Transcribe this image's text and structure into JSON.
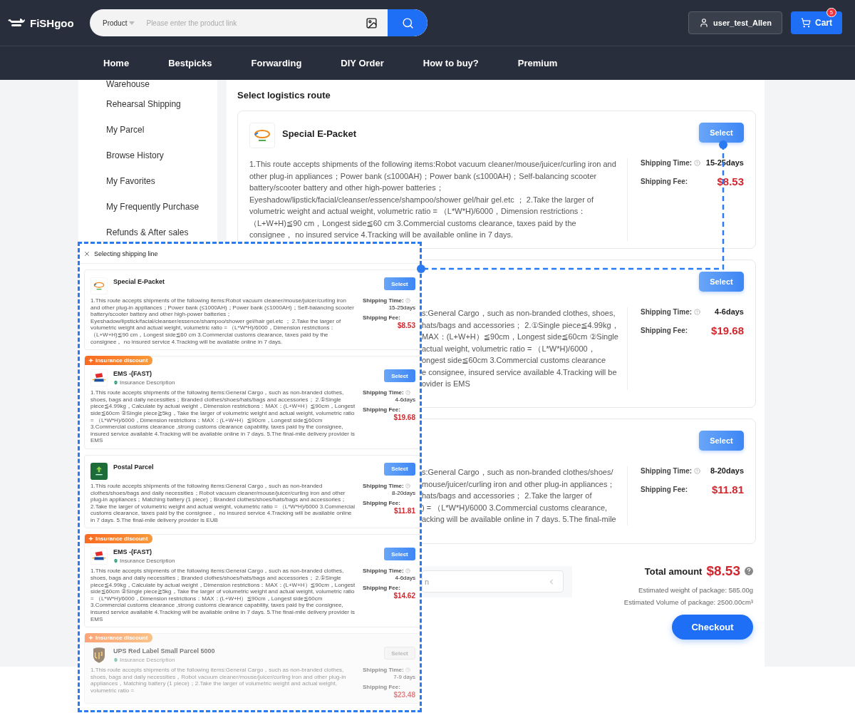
{
  "header": {
    "logo": "FiSHgoo",
    "search": {
      "category": "Product",
      "placeholder": "Please enter the product link"
    },
    "user": "user_test_Allen",
    "cart": {
      "label": "Cart",
      "badge": "5"
    }
  },
  "nav": [
    "Home",
    "Bestpicks",
    "Forwarding",
    "DIY Order",
    "How to buy?",
    "Premium"
  ],
  "sidebar": {
    "items": [
      "Warehouse",
      "Rehearsal Shipping",
      "My Parcel",
      "Browse History",
      "My Favorites",
      "My Frequently Purchase",
      "Refunds & After sales"
    ]
  },
  "content": {
    "title": "Select logistics route",
    "routes": [
      {
        "kind": "full",
        "logo": {
          "kind": "epacket"
        },
        "name": "Special E-Packet",
        "button": "Select",
        "description": "1.This route accepts shipments of the following items:Robot vacuum cleaner/mouse/juicer/curling iron and other plug-in appliances；Power bank (≤1000AH)；Power bank (≤1000AH)；Self-balancing scooter battery/scooter battery and other high-power batteries；Eyeshadow/lipstick/facial/cleanser/essence/shampoo/shower gel/hair gel.etc ；  2.Take the larger of volumetric weight and actual weight, volumetric ratio = （L*W*H)/6000，Dimension restrictions：（L+W+H)≦90 cm，Longest side≦60 cm 3.Commercial customs clearance, taxes paid by the consignee， no insured service 4.Tracking will be available online in 7 days.",
        "time_label": "Shipping Time:",
        "time": "15-25days",
        "fee_label": "Shipping Fee:",
        "fee": "$8.53"
      },
      {
        "kind": "partial",
        "button": "Select",
        "lines": [
          "s:General Cargo，such as non-branded clothes, shoes,",
          "hats/bags and accessories；  2.①Single piece≦4.99kg，",
          "MAX：(L+W+H）≦90cm，Longest side≦60cm ②Single",
          "actual weight, volumetric ratio = （L*W*H)/6000，",
          "ongest side≦60cm 3.Commercial customs clearance",
          "e consignee, insured service available 4.Tracking will be",
          "ovider is EMS"
        ],
        "time_label": "Shipping Time:",
        "time": "4-6days",
        "fee_label": "Shipping Fee:",
        "fee": "$19.68"
      },
      {
        "kind": "partial",
        "button": "Select",
        "lines": [
          "s:General Cargo，such as non-branded clothes/shoes/",
          "mouse/juicer/curling iron and other plug-in appliances；",
          "hats/bags and accessories；  2.Take the larger of",
          ") = （L*W*H)/6000 3.Commercial customs clearance,",
          "acking will be available online in 7 days. 5.The final-mile"
        ],
        "time_label": "Shipping Time:",
        "time": "8-20days",
        "fee_label": "Shipping Fee:",
        "fee": "$11.81"
      }
    ],
    "summary": {
      "field_value": "n",
      "total_label": "Total amount",
      "total": "$8.53",
      "weight": "Estimated weight of package: 585.00g",
      "volume": "Estimated Volume of package: 2500.00cm³",
      "checkout": "Checkout"
    }
  },
  "inset": {
    "title": "Selecting shipping line",
    "cards": [
      {
        "logo": {
          "kind": "epacket"
        },
        "name": "Special E-Packet",
        "button": "Select",
        "disabled": false,
        "description": "1.This route accepts shipments of the following items:Robot vacuum cleaner/mouse/juicer/curling iron and other plug-in appliances；Power bank (≤1000AH)；Power bank (≤1000AH)；Self-balancing scooter battery/scooter battery and other high-power batteries；Eyeshadow/lipstick/facial/cleanser/essence/shampoo/shower gel/hair gel.etc ；  2.Take the larger of volumetric weight and actual weight, volumetric ratio = （L*W*H)/6000，Dimension restrictions：（L+W+H)≦90 cm，Longest side≦60 cm 3.Commercial customs clearance, taxes paid by the consignee， no insured service 4.Tracking will be available online in 7 days.",
        "time_label": "Shipping Time:",
        "time": "15-25days",
        "fee_label": "Shipping Fee:",
        "fee": "$8.53"
      },
      {
        "badge": "Insurance discount",
        "logo": {
          "kind": "ems"
        },
        "name": "EMS -(FAST)",
        "insurance": "Insurance Description",
        "button": "Select",
        "disabled": false,
        "description": "1.This route accepts shipments of the following items:General Cargo，such as non-branded clothes, shoes, bags and daily necessities；Branded clothes/shoes/hats/bags and accessories；  2.①Single piece≦4.99kg，Calculate by actual weight，Dimension restrictions：MAX：(L+W+H）≦90cm，Longest side≦60cm ②Single piece≧5kg，Take the larger of volumetric weight and actual weight, volumetric ratio = （L*W*H)/6000，Dimension restrictions：MAX：(L+W+H）≦90cm，Longest side≦60cm 3.Commercial customs clearance ,strong customs clearance capability, taxes paid by the consignee, insured service available 4.Tracking will be available online in 7 days. 5.The final-mile delivery provider is EMS",
        "time_label": "Shipping Time:",
        "time": "4-6days",
        "fee_label": "Shipping Fee:",
        "fee": "$19.68"
      },
      {
        "logo": {
          "kind": "postal"
        },
        "name": "Postal Parcel",
        "button": "Select",
        "disabled": false,
        "description": "1.This route accepts shipments of the following items:General Cargo，such as non-branded clothes/shoes/bags and daily necessities；Robot vacuum cleaner/mouse/juicer/curling iron and other plug-in appliances；Matching battery (1 piece)；Branded clothes/shoes/hats/bags and accessories；  2.Take the larger of volumetric weight and actual weight, volumetric ratio = （L*W*H)/6000 3.Commercial customs clearance, taxes paid by the consignee， no insured service 4.Tracking will be available online in 7 days. 5.The final-mile delivery provider is EUB",
        "time_label": "Shipping Time:",
        "time": "8-20days",
        "fee_label": "Shipping Fee:",
        "fee": "$11.81"
      },
      {
        "badge": "Insurance discount",
        "logo": {
          "kind": "ems"
        },
        "name": "EMS -(FAST)",
        "insurance": "Insurance Description",
        "button": "Select",
        "disabled": false,
        "description": "1.This route accepts shipments of the following items:General Cargo，such as non-branded clothes, shoes, bags and daily necessities；Branded clothes/shoes/hats/bags and accessories；  2.①Single piece≦4.99kg，Calculate by actual weight，Dimension restrictions：MAX：(L+W+H）≦90cm，Longest side≦60cm ②Single piece≧5kg，Take the larger of volumetric weight and actual weight, volumetric ratio = （L*W*H)/6000，Dimension restrictions：MAX：(L+W+H）≦90cm，Longest side≦60cm 3.Commercial customs clearance ,strong customs clearance capability, taxes paid by the consignee, insured service available 4.Tracking will be available online in 7 days. 5.The final-mile delivery provider is EMS",
        "time_label": "Shipping Time:",
        "time": "4-6days",
        "fee_label": "Shipping Fee:",
        "fee": "$14.62"
      },
      {
        "badge": "Insurance discount",
        "logo": {
          "kind": "ups"
        },
        "name": "UPS Red Label Small Parcel 5000",
        "insurance": "Insurance Description",
        "button": "Select",
        "disabled": true,
        "description": "1.This route accepts shipments of the following items:General Cargo，such as non-branded clothes, shoes, bags and daily necessities，Robot vacuum cleaner/mouse/juicer/curling iron and other plug-in appliances，Matching battery (1 piece)；2.Take the larger of volumetric weight and actual weight, volumetric ratio =",
        "time_label": "Shipping Time:",
        "time": "7-9 days",
        "fee_label": "Shipping Fee:",
        "fee": "$23.48"
      }
    ]
  }
}
